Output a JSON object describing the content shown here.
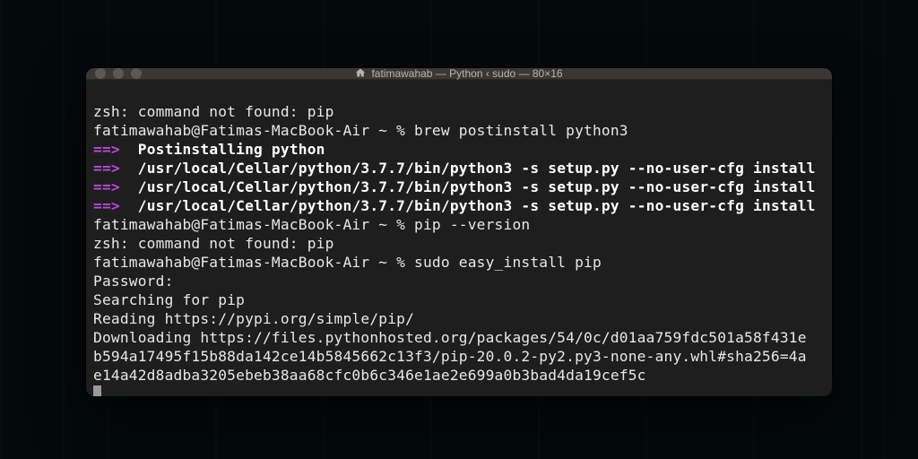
{
  "window": {
    "title": "fatimawahab — Python ‹ sudo — 80×16",
    "traffic_lights": {
      "close": "close",
      "minimize": "minimize",
      "zoom": "zoom"
    }
  },
  "term": {
    "l1": "zsh: command not found: pip",
    "l2": "fatimawahab@Fatimas-MacBook-Air ~ % brew postinstall python3",
    "arrow": "==>",
    "h1": "Postinstalling python",
    "h2": "/usr/local/Cellar/python/3.7.7/bin/python3 -s setup.py --no-user-cfg install",
    "h3": "/usr/local/Cellar/python/3.7.7/bin/python3 -s setup.py --no-user-cfg install",
    "h4": "/usr/local/Cellar/python/3.7.7/bin/python3 -s setup.py --no-user-cfg install",
    "l3": "fatimawahab@Fatimas-MacBook-Air ~ % pip --version",
    "l4": "zsh: command not found: pip",
    "l5": "fatimawahab@Fatimas-MacBook-Air ~ % sudo easy_install pip",
    "l6": "Password:",
    "l7": "Searching for pip",
    "l8": "Reading https://pypi.org/simple/pip/",
    "l9": "Downloading https://files.pythonhosted.org/packages/54/0c/d01aa759fdc501a58f431e",
    "l10": "b594a17495f15b88da142ce14b5845662c13f3/pip-20.0.2-py2.py3-none-any.whl#sha256=4a",
    "l11": "e14a42d8adba3205ebeb38aa68cfc0b6c346e1ae2e699a0b3bad4da19cef5c"
  }
}
